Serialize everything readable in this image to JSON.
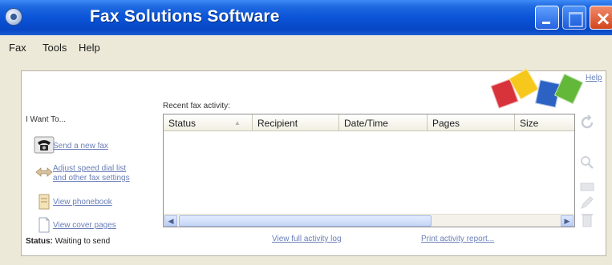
{
  "window": {
    "title": "Fax Solutions Software"
  },
  "menu": {
    "items": [
      "Fax",
      "Tools",
      "Help"
    ]
  },
  "help_link": "Help",
  "sidebar": {
    "heading": "I Want To...",
    "actions": [
      {
        "label": "Send a new fax",
        "icon": "fax-phone-icon"
      },
      {
        "label_line1": "Adjust speed dial list",
        "label_line2": "and other fax settings",
        "icon": "speed-dial-icon"
      },
      {
        "label": "View phonebook",
        "icon": "phonebook-icon"
      },
      {
        "label": "View cover pages",
        "icon": "cover-page-icon"
      }
    ],
    "status_label": "Status:",
    "status_value": "Waiting to send"
  },
  "activity": {
    "label": "Recent fax activity:",
    "columns": [
      "Status",
      "Recipient",
      "Date/Time",
      "Pages",
      "Size"
    ],
    "rows": [],
    "links": {
      "full_log": "View full activity log",
      "print_report": "Print activity report..."
    }
  },
  "colors": {
    "titlebar": "#0a53d8",
    "link": "#6a7fb8",
    "logo": [
      "#d8333a",
      "#f6c81b",
      "#2b62c4",
      "#63b83a"
    ]
  },
  "toolbar_icons": [
    "refresh-icon",
    "search-icon",
    "compose-icon",
    "edit-icon",
    "delete-icon"
  ]
}
